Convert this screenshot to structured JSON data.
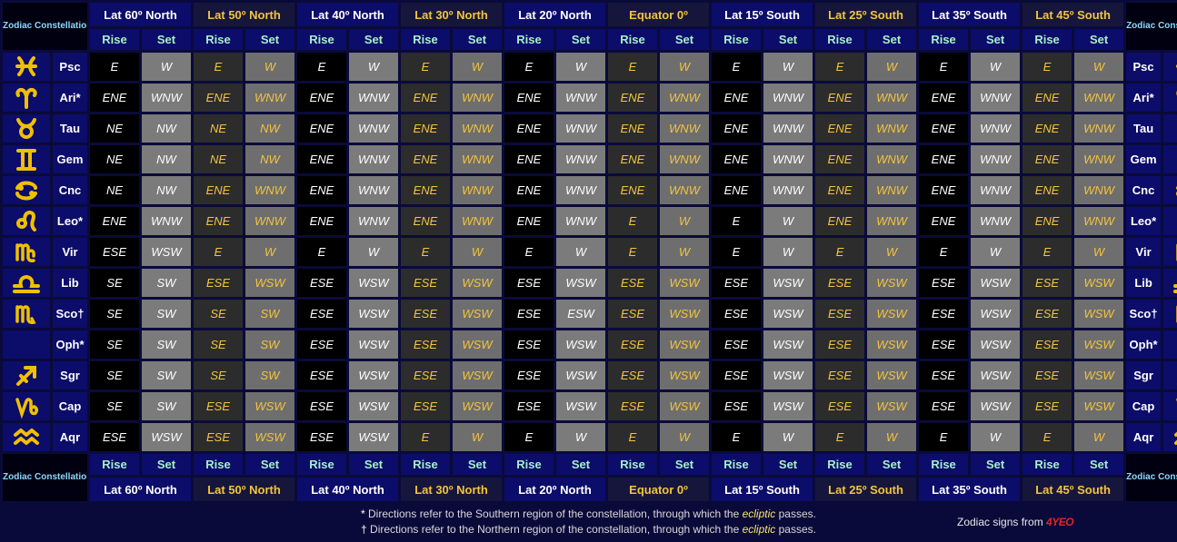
{
  "header": {
    "zodiac_label": "Zodiac Constellation",
    "latitudes": [
      {
        "label": "Lat 60º North",
        "color": "#ffffff"
      },
      {
        "label": "Lat 50º North",
        "color": "#f2c43e"
      },
      {
        "label": "Lat 40º North",
        "color": "#ffffff"
      },
      {
        "label": "Lat 30º North",
        "color": "#f2c43e"
      },
      {
        "label": "Lat 20º North",
        "color": "#ffffff"
      },
      {
        "label": "Equator 0º",
        "color": "#f2c43e"
      },
      {
        "label": "Lat 15º South",
        "color": "#ffffff"
      },
      {
        "label": "Lat 25º South",
        "color": "#f2c43e"
      },
      {
        "label": "Lat 35º South",
        "color": "#ffffff"
      },
      {
        "label": "Lat 45º South",
        "color": "#f2c43e"
      }
    ],
    "rise_label": "Rise",
    "set_label": "Set"
  },
  "rows": [
    {
      "abbr": "Psc",
      "icon": "pisces-icon",
      "cells": [
        "E",
        "W",
        "E",
        "W",
        "E",
        "W",
        "E",
        "W",
        "E",
        "W",
        "E",
        "W",
        "E",
        "W",
        "E",
        "W",
        "E",
        "W",
        "E",
        "W"
      ]
    },
    {
      "abbr": "Ari*",
      "icon": "aries-icon",
      "cells": [
        "ENE",
        "WNW",
        "ENE",
        "WNW",
        "ENE",
        "WNW",
        "ENE",
        "WNW",
        "ENE",
        "WNW",
        "ENE",
        "WNW",
        "ENE",
        "WNW",
        "ENE",
        "WNW",
        "ENE",
        "WNW",
        "ENE",
        "WNW"
      ]
    },
    {
      "abbr": "Tau",
      "icon": "taurus-icon",
      "cells": [
        "NE",
        "NW",
        "NE",
        "NW",
        "ENE",
        "WNW",
        "ENE",
        "WNW",
        "ENE",
        "WNW",
        "ENE",
        "WNW",
        "ENE",
        "WNW",
        "ENE",
        "WNW",
        "ENE",
        "WNW",
        "ENE",
        "WNW"
      ]
    },
    {
      "abbr": "Gem",
      "icon": "gemini-icon",
      "cells": [
        "NE",
        "NW",
        "NE",
        "NW",
        "ENE",
        "WNW",
        "ENE",
        "WNW",
        "ENE",
        "WNW",
        "ENE",
        "WNW",
        "ENE",
        "WNW",
        "ENE",
        "WNW",
        "ENE",
        "WNW",
        "ENE",
        "WNW"
      ]
    },
    {
      "abbr": "Cnc",
      "icon": "cancer-icon",
      "cells": [
        "NE",
        "NW",
        "ENE",
        "WNW",
        "ENE",
        "WNW",
        "ENE",
        "WNW",
        "ENE",
        "WNW",
        "ENE",
        "WNW",
        "ENE",
        "WNW",
        "ENE",
        "WNW",
        "ENE",
        "WNW",
        "ENE",
        "WNW"
      ]
    },
    {
      "abbr": "Leo*",
      "icon": "leo-icon",
      "cells": [
        "ENE",
        "WNW",
        "ENE",
        "WNW",
        "ENE",
        "WNW",
        "ENE",
        "WNW",
        "ENE",
        "WNW",
        "E",
        "W",
        "E",
        "W",
        "ENE",
        "WNW",
        "ENE",
        "WNW",
        "ENE",
        "WNW"
      ]
    },
    {
      "abbr": "Vir",
      "icon": "virgo-icon",
      "cells": [
        "ESE",
        "WSW",
        "E",
        "W",
        "E",
        "W",
        "E",
        "W",
        "E",
        "W",
        "E",
        "W",
        "E",
        "W",
        "E",
        "W",
        "E",
        "W",
        "E",
        "W"
      ]
    },
    {
      "abbr": "Lib",
      "icon": "libra-icon",
      "cells": [
        "SE",
        "SW",
        "ESE",
        "WSW",
        "ESE",
        "WSW",
        "ESE",
        "WSW",
        "ESE",
        "WSW",
        "ESE",
        "WSW",
        "ESE",
        "WSW",
        "ESE",
        "WSW",
        "ESE",
        "WSW",
        "ESE",
        "WSW"
      ]
    },
    {
      "abbr": "Sco†",
      "icon": "scorpio-icon",
      "cells": [
        "SE",
        "SW",
        "SE",
        "SW",
        "ESE",
        "WSW",
        "ESE",
        "WSW",
        "ESE",
        "ESW",
        "ESE",
        "WSW",
        "ESE",
        "WSW",
        "ESE",
        "WSW",
        "ESE",
        "WSW",
        "ESE",
        "WSW"
      ]
    },
    {
      "abbr": "Oph*",
      "icon": "",
      "cells": [
        "SE",
        "SW",
        "SE",
        "SW",
        "ESE",
        "WSW",
        "ESE",
        "WSW",
        "ESE",
        "WSW",
        "ESE",
        "WSW",
        "ESE",
        "WSW",
        "ESE",
        "WSW",
        "ESE",
        "WSW",
        "ESE",
        "WSW"
      ]
    },
    {
      "abbr": "Sgr",
      "icon": "sagittarius-icon",
      "cells": [
        "SE",
        "SW",
        "SE",
        "SW",
        "ESE",
        "WSW",
        "ESE",
        "WSW",
        "ESE",
        "WSW",
        "ESE",
        "WSW",
        "ESE",
        "WSW",
        "ESE",
        "WSW",
        "ESE",
        "WSW",
        "ESE",
        "WSW"
      ]
    },
    {
      "abbr": "Cap",
      "icon": "capricorn-icon",
      "cells": [
        "SE",
        "SW",
        "ESE",
        "WSW",
        "ESE",
        "WSW",
        "ESE",
        "WSW",
        "ESE",
        "WSW",
        "ESE",
        "WSW",
        "ESE",
        "WSW",
        "ESE",
        "WSW",
        "ESE",
        "WSW",
        "ESE",
        "WSW"
      ]
    },
    {
      "abbr": "Aqr",
      "icon": "aquarius-icon",
      "cells": [
        "ESE",
        "WSW",
        "ESE",
        "WSW",
        "ESE",
        "WSW",
        "E",
        "W",
        "E",
        "W",
        "E",
        "W",
        "E",
        "W",
        "E",
        "W",
        "E",
        "W",
        "E",
        "W"
      ]
    }
  ],
  "footnotes": {
    "star_mark": "*",
    "star_text_before": " Directions refer to the Southern region of the constellation, through which the ",
    "dagger_mark": "†",
    "dagger_text_before": " Directions refer to the Northern region of the constellation, through which the ",
    "highlight": "ecliptic",
    "text_after": " passes."
  },
  "credit": {
    "text": "Zodiac signs from ",
    "brand": "4YEO"
  },
  "colors": {
    "background": "#0a0a3a",
    "header_blue": "#0c0c6a",
    "gold": "#f2c43e",
    "rise_set_green": "#a6f0c8",
    "glyph_gold": "#f0c000"
  }
}
